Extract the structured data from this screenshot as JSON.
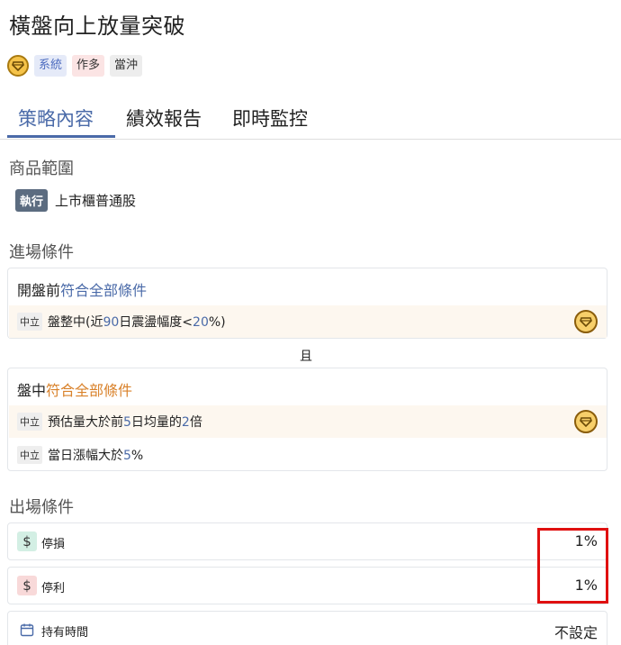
{
  "title": "橫盤向上放量突破",
  "tags": {
    "system": "系統",
    "long": "作多",
    "daytrade": "當沖"
  },
  "tabs": [
    {
      "label": "策略內容",
      "active": true
    },
    {
      "label": "績效報告",
      "active": false
    },
    {
      "label": "即時監控",
      "active": false
    }
  ],
  "scope": {
    "heading": "商品範圍",
    "badge": "執行",
    "text": "上市櫃普通股"
  },
  "entry": {
    "heading": "進場條件",
    "group1": {
      "prefix": "開盤前",
      "match": "符合全部條件",
      "conditions": [
        {
          "badge": "中立",
          "t1": "盤整中(近",
          "n1": "90",
          "t2": "日震盪幅度<",
          "n2": "20",
          "t3": "%)"
        }
      ]
    },
    "and": "且",
    "group2": {
      "prefix": "盤中",
      "match": "符合全部條件",
      "conditions": [
        {
          "badge": "中立",
          "t1": "預估量大於前",
          "n1": "5",
          "t2": "日均量的",
          "n2": "2",
          "t3": "倍"
        },
        {
          "badge": "中立",
          "t1": "當日漲幅大於",
          "n1": "5",
          "t2": "%"
        }
      ]
    }
  },
  "exit": {
    "heading": "出場條件",
    "rows": [
      {
        "icon": "$",
        "label": "停損",
        "value": "1%"
      },
      {
        "icon": "$",
        "label": "停利",
        "value": "1%"
      },
      {
        "label": "持有時間",
        "value": "不設定"
      }
    ]
  },
  "colors": {
    "accent": "#4a6aa8",
    "highlight_orange": "#d9822b",
    "annotation_red": "#e01010"
  }
}
